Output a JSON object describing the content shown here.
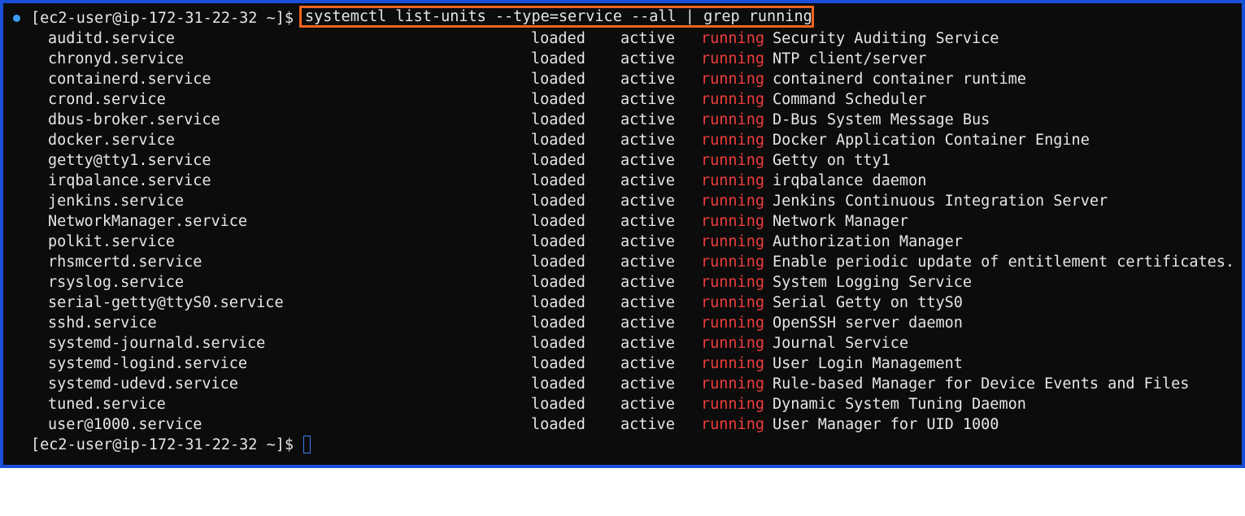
{
  "terminal": {
    "prompt": "[ec2-user@ip-172-31-22-32 ~]$",
    "command": "systemctl list-units --type=service --all | grep running",
    "rows": [
      {
        "unit": "auditd.service",
        "load": "loaded",
        "active": "active",
        "sub": "running",
        "description": "Security Auditing Service"
      },
      {
        "unit": "chronyd.service",
        "load": "loaded",
        "active": "active",
        "sub": "running",
        "description": "NTP client/server"
      },
      {
        "unit": "containerd.service",
        "load": "loaded",
        "active": "active",
        "sub": "running",
        "description": "containerd container runtime"
      },
      {
        "unit": "crond.service",
        "load": "loaded",
        "active": "active",
        "sub": "running",
        "description": "Command Scheduler"
      },
      {
        "unit": "dbus-broker.service",
        "load": "loaded",
        "active": "active",
        "sub": "running",
        "description": "D-Bus System Message Bus"
      },
      {
        "unit": "docker.service",
        "load": "loaded",
        "active": "active",
        "sub": "running",
        "description": "Docker Application Container Engine"
      },
      {
        "unit": "getty@tty1.service",
        "load": "loaded",
        "active": "active",
        "sub": "running",
        "description": "Getty on tty1"
      },
      {
        "unit": "irqbalance.service",
        "load": "loaded",
        "active": "active",
        "sub": "running",
        "description": "irqbalance daemon"
      },
      {
        "unit": "jenkins.service",
        "load": "loaded",
        "active": "active",
        "sub": "running",
        "description": "Jenkins Continuous Integration Server"
      },
      {
        "unit": "NetworkManager.service",
        "load": "loaded",
        "active": "active",
        "sub": "running",
        "description": "Network Manager"
      },
      {
        "unit": "polkit.service",
        "load": "loaded",
        "active": "active",
        "sub": "running",
        "description": "Authorization Manager"
      },
      {
        "unit": "rhsmcertd.service",
        "load": "loaded",
        "active": "active",
        "sub": "running",
        "description": "Enable periodic update of entitlement certificates."
      },
      {
        "unit": "rsyslog.service",
        "load": "loaded",
        "active": "active",
        "sub": "running",
        "description": "System Logging Service"
      },
      {
        "unit": "serial-getty@ttyS0.service",
        "load": "loaded",
        "active": "active",
        "sub": "running",
        "description": "Serial Getty on ttyS0"
      },
      {
        "unit": "sshd.service",
        "load": "loaded",
        "active": "active",
        "sub": "running",
        "description": "OpenSSH server daemon"
      },
      {
        "unit": "systemd-journald.service",
        "load": "loaded",
        "active": "active",
        "sub": "running",
        "description": "Journal Service"
      },
      {
        "unit": "systemd-logind.service",
        "load": "loaded",
        "active": "active",
        "sub": "running",
        "description": "User Login Management"
      },
      {
        "unit": "systemd-udevd.service",
        "load": "loaded",
        "active": "active",
        "sub": "running",
        "description": "Rule-based Manager for Device Events and Files"
      },
      {
        "unit": "tuned.service",
        "load": "loaded",
        "active": "active",
        "sub": "running",
        "description": "Dynamic System Tuning Daemon"
      },
      {
        "unit": "user@1000.service",
        "load": "loaded",
        "active": "active",
        "sub": "running",
        "description": "User Manager for UID 1000"
      }
    ],
    "colors": {
      "background": "#0c0c0c",
      "frame": "#1a4fd8",
      "highlight": "#f0641e",
      "running": "#f03c3c",
      "text": "#e6e6e6"
    }
  }
}
